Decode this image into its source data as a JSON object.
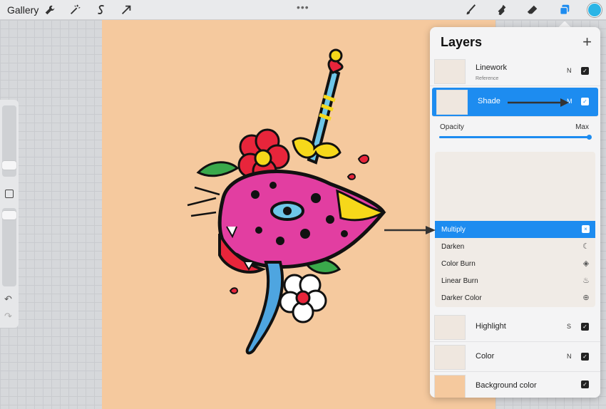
{
  "toolbar": {
    "gallery_label": "Gallery",
    "left_tools": [
      {
        "icon": "wrench-icon"
      },
      {
        "icon": "magic-wand-icon"
      },
      {
        "icon": "selection-s-icon"
      },
      {
        "icon": "transform-arrow-icon"
      }
    ],
    "more_dots": "•••",
    "right_tools": [
      {
        "icon": "brush-icon"
      },
      {
        "icon": "smudge-icon"
      },
      {
        "icon": "eraser-icon"
      },
      {
        "icon": "layers-icon"
      }
    ],
    "current_color": "#2bb5e6"
  },
  "sidebar": {
    "undo_icon": "↶",
    "redo_icon": "↷"
  },
  "layers_panel": {
    "title": "Layers",
    "add_icon": "+",
    "layers_top": [
      {
        "name": "Linework",
        "sub": "Reference",
        "mode": "N",
        "visible": true,
        "selected": false
      },
      {
        "name": "Shade",
        "sub": "",
        "mode": "M",
        "visible": true,
        "selected": true
      }
    ],
    "opacity": {
      "label": "Opacity",
      "max_label": "Max",
      "value": 1.0
    },
    "blend_modes": [
      {
        "name": "Multiply",
        "icon": "×",
        "selected": true
      },
      {
        "name": "Darken",
        "icon": "☾",
        "selected": false
      },
      {
        "name": "Color Burn",
        "icon": "◈",
        "selected": false
      },
      {
        "name": "Linear Burn",
        "icon": "♨",
        "selected": false
      },
      {
        "name": "Darker Color",
        "icon": "⊕",
        "selected": false
      }
    ],
    "layers_bottom": [
      {
        "name": "Highlight",
        "mode": "S",
        "visible": true
      },
      {
        "name": "Color",
        "mode": "N",
        "visible": true
      },
      {
        "name": "Background color",
        "mode": "",
        "visible": true
      }
    ]
  },
  "colors": {
    "accent": "#1d8cf0",
    "canvas_bg": "#f5c99e"
  }
}
